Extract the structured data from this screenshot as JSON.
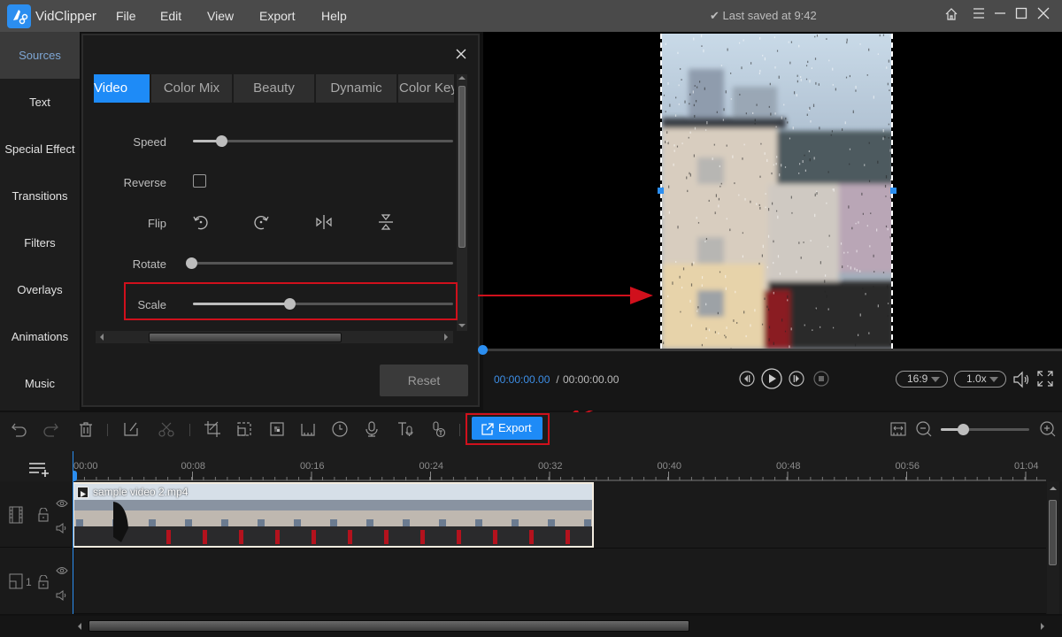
{
  "app": {
    "name": "VidClipper",
    "saved_status": "Last saved at 9:42"
  },
  "menu": [
    "File",
    "Edit",
    "View",
    "Export",
    "Help"
  ],
  "window_controls": [
    "home-icon",
    "hamburger-menu-icon",
    "minimize-icon",
    "maximize-icon",
    "close-icon"
  ],
  "sidebar": {
    "items": [
      {
        "label": "Sources",
        "active": true
      },
      {
        "label": "Text"
      },
      {
        "label": "Special Effect"
      },
      {
        "label": "Transitions"
      },
      {
        "label": "Filters"
      },
      {
        "label": "Overlays"
      },
      {
        "label": "Animations"
      },
      {
        "label": "Music"
      }
    ]
  },
  "panel": {
    "tabs": [
      {
        "label": "Video",
        "active": true
      },
      {
        "label": "Color Mix"
      },
      {
        "label": "Beauty"
      },
      {
        "label": "Dynamic"
      },
      {
        "label": "Color Key"
      }
    ],
    "rows": {
      "speed": {
        "label": "Speed",
        "value": 0.11
      },
      "reverse": {
        "label": "Reverse",
        "checked": false
      },
      "flip": {
        "label": "Flip",
        "icons": [
          "rotate-left-icon",
          "rotate-right-icon",
          "flip-horizontal-icon",
          "flip-vertical-icon"
        ]
      },
      "rotate": {
        "label": "Rotate",
        "value": 0.0
      },
      "scale": {
        "label": "Scale",
        "value": 0.37
      }
    },
    "reset_label": "Reset"
  },
  "player": {
    "current_time": "00:00:00.00",
    "separator": " / ",
    "total_time": "00:00:00.00",
    "aspect_ratio": "16:9",
    "speed": "1.0x"
  },
  "toolbar": {
    "export_label": "Export",
    "icons": [
      "undo-icon",
      "redo-icon",
      "delete-icon",
      "edit-icon",
      "split-icon",
      "crop-icon",
      "resize-icon",
      "mosaic-icon",
      "freeze-icon",
      "duration-icon",
      "voiceover-icon",
      "text-to-speech-icon",
      "speech-to-text-icon"
    ]
  },
  "timeline": {
    "ticks": [
      "00:00",
      "00:08",
      "00:16",
      "00:24",
      "00:32",
      "00:40",
      "00:48",
      "00:56",
      "01:04"
    ],
    "clip": {
      "name": "sample video 2.mp4"
    },
    "pip_track_label": "1",
    "zoom_level": 0.25
  },
  "colors": {
    "accent": "#1e8bf7",
    "highlight": "#d0101c"
  }
}
